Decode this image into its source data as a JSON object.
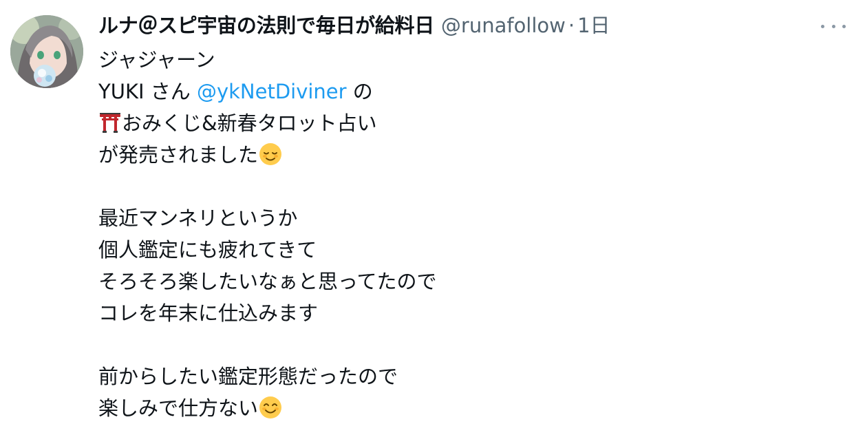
{
  "tweet": {
    "author": {
      "display_name": "ルナ＠スピ宇宙の法則で毎日が給料日",
      "handle": "@runafollow",
      "avatar_icon": "avatar-image"
    },
    "separator": "·",
    "timestamp": "1日",
    "more_icon": "more-options-icon",
    "lines": {
      "l1": "ジャジャーン",
      "l2_pre": "YUKI さん ",
      "l2_mention": "@ykNetDiviner",
      "l2_post": " の",
      "l3_text": "おみくじ&新春タロット占い",
      "l4_text": "が発売されました",
      "l5": "最近マンネリというか",
      "l6": "個人鑑定にも疲れてきて",
      "l7": "そろそろ楽したいなぁと思ってたので",
      "l8": "コレを年末に仕込みます",
      "l9": "前からしたい鑑定形態だったので",
      "l10_text": "楽しみで仕方ない"
    },
    "emojis": {
      "torii": "shinto-shrine-emoji",
      "relieved": "relieved-face-emoji",
      "smiling": "smiling-face-emoji"
    },
    "colors": {
      "text": "#0f1419",
      "secondary": "#536471",
      "link": "#1d9bf0"
    }
  }
}
